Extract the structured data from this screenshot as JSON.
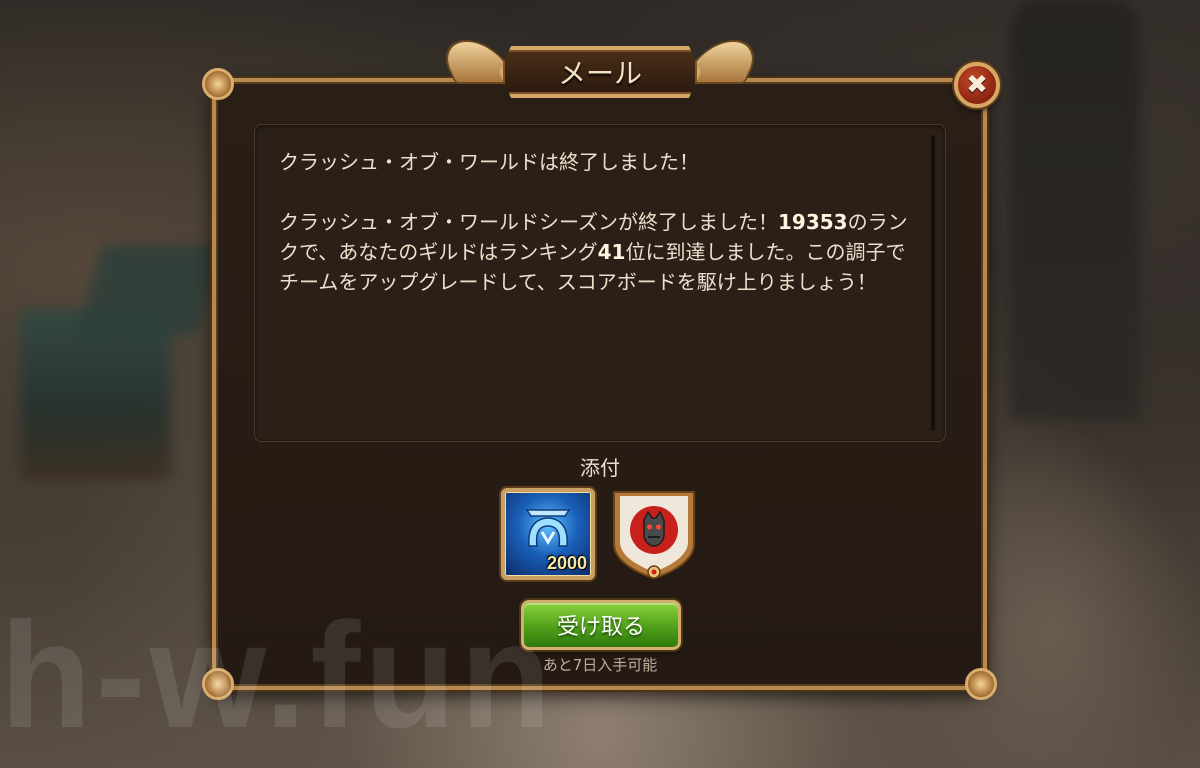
{
  "window": {
    "title": "メール"
  },
  "close": {
    "icon": "close-icon",
    "symbol": "✖"
  },
  "message": {
    "title": "クラッシュ・オブ・ワールドは終了しました！",
    "body_part1": "クラッシュ・オブ・ワールドシーズンが終了しました！",
    "score": "19353",
    "body_part2": "のランクで、あなたのギルドはランキング",
    "rank": "41",
    "body_part3": "位に到達しました。この調子でチームをアップグレードして、スコアボードを駆け上りましょう！"
  },
  "attachments": {
    "label": "添付",
    "items": [
      {
        "icon": "rune-icon",
        "count": "2000"
      },
      {
        "icon": "guild-banner-icon"
      }
    ]
  },
  "actions": {
    "claim_label": "受け取る",
    "expire_note": "あと7日入手可能"
  },
  "watermark": "h-w.fun",
  "colors": {
    "gold_frame": "#b7894f",
    "panel_bg": "#241a13",
    "claim_green": "#4fa01a",
    "close_red": "#8a2410",
    "rune_blue": "#1a5fb8",
    "banner_red": "#c8201c"
  }
}
